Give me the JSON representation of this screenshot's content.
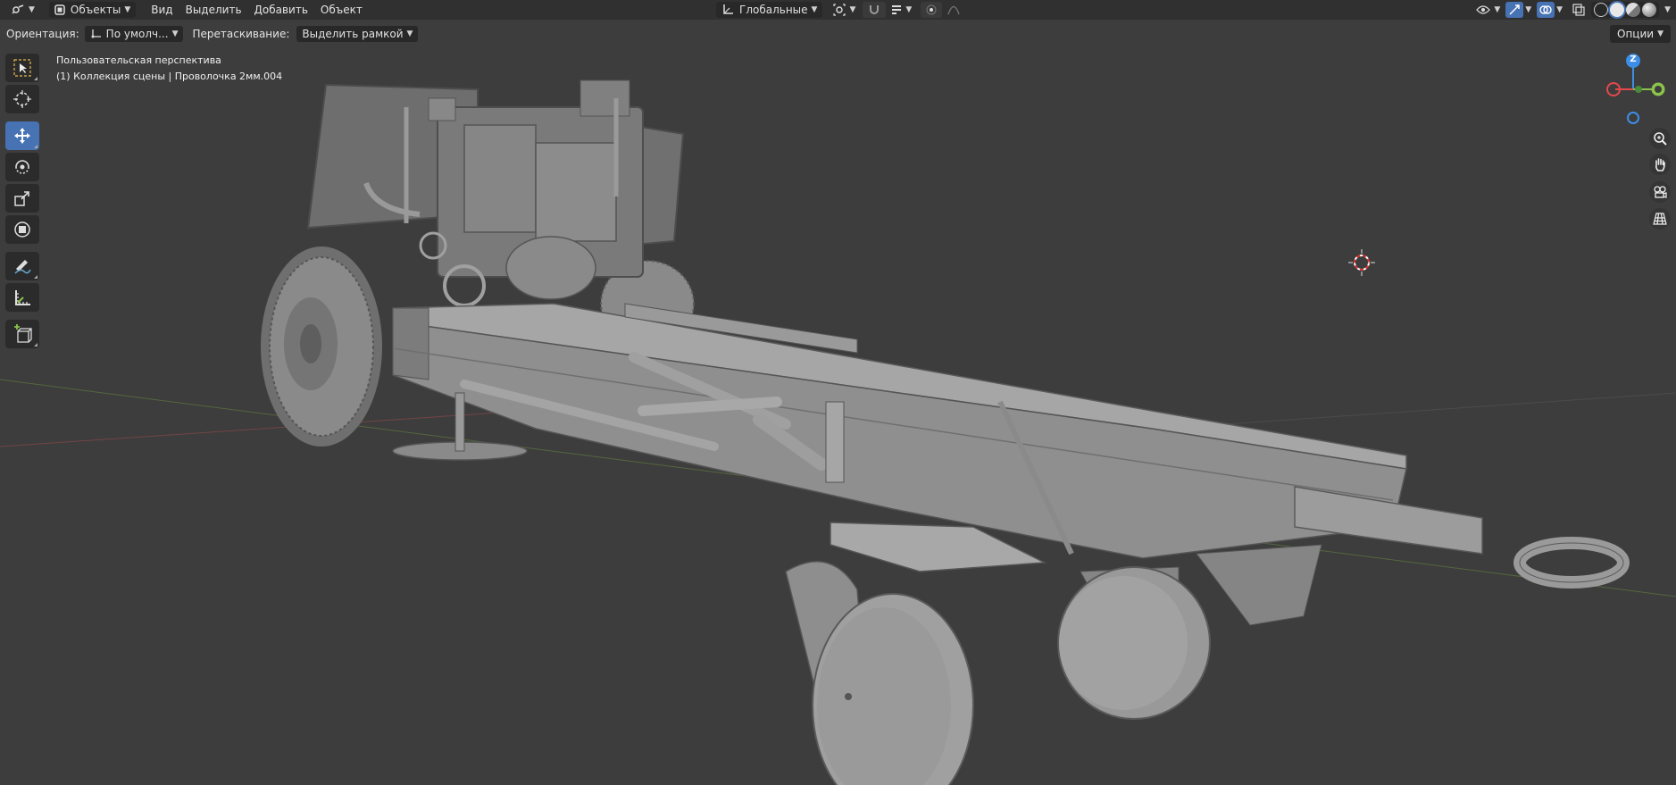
{
  "header": {
    "mode_label": "Объекты",
    "menus": [
      "Вид",
      "Выделить",
      "Добавить",
      "Объект"
    ],
    "transform_orientation": "Глобальные"
  },
  "tool_header": {
    "orientation_label": "Ориентация:",
    "orientation_value": "По умолч...",
    "drag_label": "Перетаскивание:",
    "drag_value": "Выделить рамкой",
    "options_label": "Опции"
  },
  "viewport": {
    "view_name": "Пользовательская перспектива",
    "collection_info": "(1) Коллекция сцены | Проволочка 2мм.004",
    "gizmo_z": "Z"
  },
  "tools": [
    {
      "name": "select-box-tool",
      "icon": "select-box-icon"
    },
    {
      "name": "cursor-tool",
      "icon": "cursor-icon"
    },
    {
      "name": "move-tool",
      "icon": "move-icon",
      "active": true
    },
    {
      "name": "rotate-tool",
      "icon": "rotate-icon"
    },
    {
      "name": "scale-tool",
      "icon": "scale-icon"
    },
    {
      "name": "transform-tool",
      "icon": "transform-icon"
    },
    {
      "name": "annotate-tool",
      "icon": "annotate-icon"
    },
    {
      "name": "measure-tool",
      "icon": "measure-icon"
    },
    {
      "name": "add-cube-tool",
      "icon": "add-cube-icon"
    }
  ],
  "colors": {
    "header_bg": "#303030",
    "viewport_bg": "#3d3d3d",
    "accent": "#4772b3",
    "axis_x": "#e5484d",
    "axis_y": "#8bc34a",
    "axis_z": "#3d8ee6",
    "model": "#8c8c8c"
  }
}
